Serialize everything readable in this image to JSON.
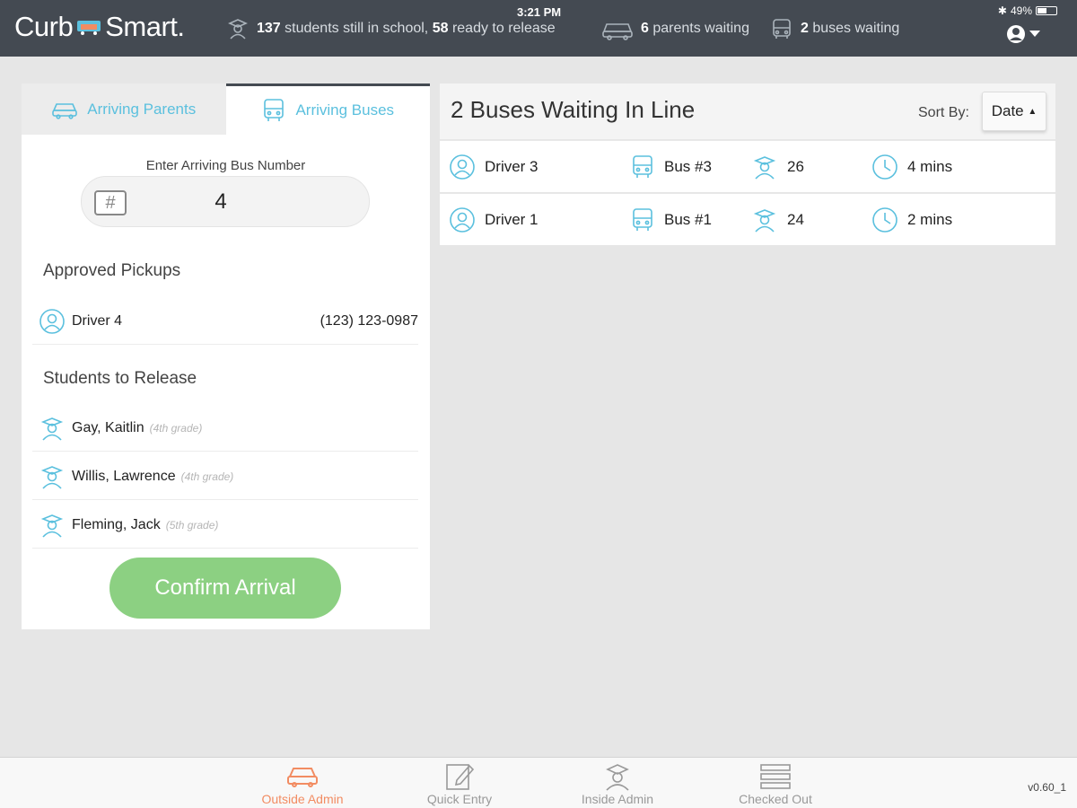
{
  "status_bar": {
    "time": "3:21 PM",
    "battery": "49%",
    "battery_level": 0.49
  },
  "header": {
    "logo_left": "Curb",
    "logo_right": "Smart",
    "logo_dot": ".",
    "students_count": "137",
    "students_text": "students still in school,",
    "ready_count": "58",
    "ready_text": "ready to release",
    "parents_count": "6",
    "parents_text": "parents waiting",
    "buses_count": "2",
    "buses_text": "buses waiting"
  },
  "tabs": [
    {
      "label": "Arriving Parents",
      "icon": "car-icon",
      "active": false
    },
    {
      "label": "Arriving Buses",
      "icon": "bus-icon",
      "active": true
    }
  ],
  "bus_entry": {
    "label": "Enter Arriving Bus Number",
    "value": "4",
    "icon": "hash-icon"
  },
  "approved_pickups": {
    "title": "Approved Pickups",
    "items": [
      {
        "name": "Driver 4",
        "phone": "(123) 123-0987"
      }
    ]
  },
  "students_to_release": {
    "title": "Students to Release",
    "items": [
      {
        "name": "Gay, Kaitlin",
        "grade": "(4th grade)"
      },
      {
        "name": "Willis, Lawrence",
        "grade": "(4th grade)"
      },
      {
        "name": "Fleming, Jack",
        "grade": "(5th grade)"
      }
    ]
  },
  "confirm_button": "Confirm Arrival",
  "queue": {
    "title": "2 Buses Waiting In Line",
    "sort_label": "Sort By:",
    "sort_value": "Date",
    "rows": [
      {
        "driver": "Driver 3",
        "bus": "Bus #3",
        "students": "26",
        "wait": "4 mins"
      },
      {
        "driver": "Driver 1",
        "bus": "Bus #1",
        "students": "24",
        "wait": "2 mins"
      }
    ]
  },
  "bottom_nav": [
    {
      "label": "Outside Admin",
      "icon": "car-icon",
      "active": true
    },
    {
      "label": "Quick Entry",
      "icon": "pencil-icon",
      "active": false
    },
    {
      "label": "Inside Admin",
      "icon": "student-icon",
      "active": false
    },
    {
      "label": "Checked Out",
      "icon": "list-icon",
      "active": false
    }
  ],
  "version": "v0.60_1",
  "colors": {
    "accent": "#5bc0de",
    "header_bg": "#444a52",
    "confirm": "#8cd082",
    "nav_active": "#f28c62"
  }
}
